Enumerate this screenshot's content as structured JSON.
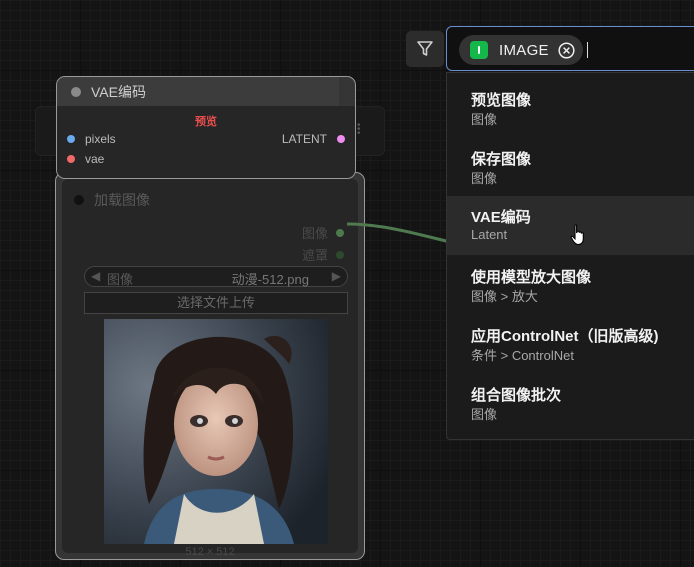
{
  "load_node": {
    "title": "加载图像",
    "outputs": [
      "图像",
      "遮罩"
    ],
    "combo_label": "图像",
    "combo_value": "动漫-512.png",
    "upload_label": "选择文件上传",
    "image_size": "512 × 512"
  },
  "vae_node": {
    "title": "VAE编码",
    "preview_tag": "预览",
    "inputs": [
      "pixels",
      "vae"
    ],
    "output": "LATENT"
  },
  "search": {
    "chip_label": "IMAGE",
    "icons": [
      "filter-icon",
      "close-circle-icon",
      "hand-cursor-icon"
    ]
  },
  "results": [
    {
      "title": "预览图像",
      "sub": "图像"
    },
    {
      "title": "保存图像",
      "sub": "图像"
    },
    {
      "title": "VAE编码",
      "sub": "Latent"
    },
    {
      "title": "使用模型放大图像",
      "sub": "图像 > 放大"
    },
    {
      "title": "应用ControlNet（旧版高级)",
      "sub": "条件 > ControlNet"
    },
    {
      "title": "组合图像批次",
      "sub": "图像"
    }
  ],
  "colors": {
    "accent": "#6a8fd0",
    "chip_badge": "#14b84a",
    "preview_tag": "#e84d4d",
    "pixels_slot": "#6aa8f0",
    "vae_slot": "#f06a6a",
    "latent_slot": "#f08cf0",
    "image_output": "#5a8a5a"
  }
}
